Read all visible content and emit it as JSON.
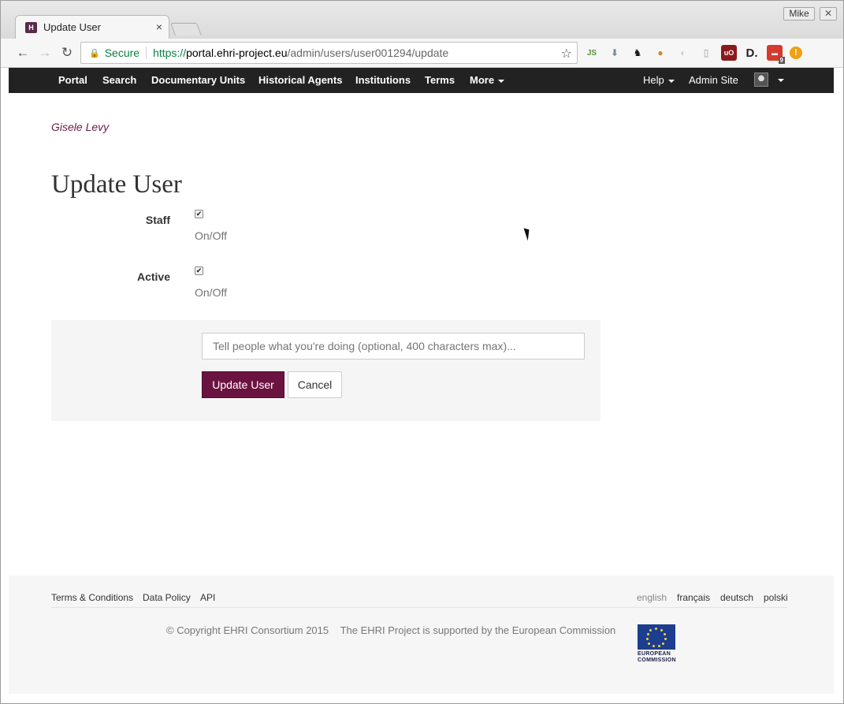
{
  "browser": {
    "tab_title": "Update User",
    "tab_close": "×",
    "user_badge": "Mike",
    "window_close": "✕",
    "secure_label": "Secure",
    "url_scheme": "https://",
    "url_host": "portal.ehri-project.eu",
    "url_path": "/admin/users/user001294/update",
    "extension_badge": "9",
    "icons": [
      "back-icon",
      "forward-icon",
      "reload-icon",
      "lock-icon",
      "star-icon"
    ]
  },
  "navbar": {
    "items": [
      "Portal",
      "Search",
      "Documentary Units",
      "Historical Agents",
      "Institutions",
      "Terms",
      "More"
    ],
    "help": "Help",
    "admin": "Admin Site"
  },
  "page": {
    "username": "Gisele Levy",
    "title": "Update User",
    "fields": [
      {
        "label": "Staff",
        "checked": true,
        "help": "On/Off"
      },
      {
        "label": "Active",
        "checked": true,
        "help": "On/Off"
      }
    ],
    "log_placeholder": "Tell people what you're doing (optional, 400 characters max)...",
    "submit_label": "Update User",
    "cancel_label": "Cancel"
  },
  "footer": {
    "links": [
      "Terms & Conditions",
      "Data Policy",
      "API"
    ],
    "languages": [
      "english",
      "français",
      "deutsch",
      "polski"
    ],
    "active_language": "english",
    "copyright": "© Copyright EHRI Consortium 2015",
    "support": "The EHRI Project is supported by the European Commission",
    "eu_logo_text": [
      "EUROPEAN",
      "COMMISSION"
    ]
  },
  "colors": {
    "brand": "#6b1340",
    "navbar": "#222222",
    "secure": "#0b8043"
  }
}
